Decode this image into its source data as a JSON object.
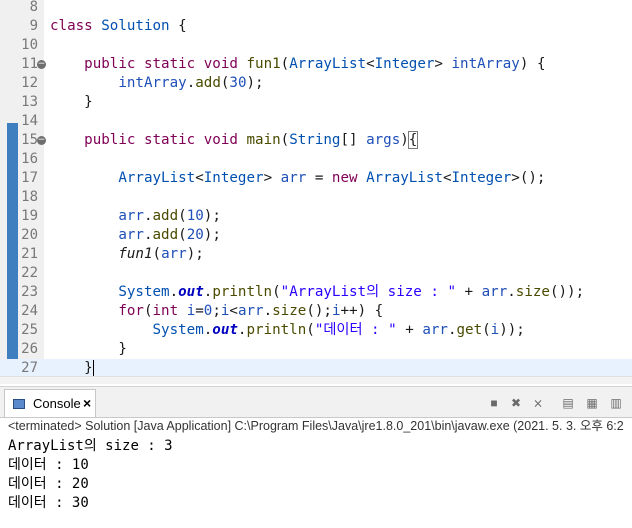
{
  "editor": {
    "lines": [
      {
        "num": "8",
        "text": ""
      },
      {
        "num": "9",
        "text": "class Solution {"
      },
      {
        "num": "10",
        "text": ""
      },
      {
        "num": "11",
        "text": "    public static void fun1(ArrayList<Integer> intArray) {"
      },
      {
        "num": "12",
        "text": "        intArray.add(30);"
      },
      {
        "num": "13",
        "text": "    }"
      },
      {
        "num": "14",
        "text": ""
      },
      {
        "num": "15",
        "text": "    public static void main(String[] args){"
      },
      {
        "num": "16",
        "text": ""
      },
      {
        "num": "17",
        "text": "        ArrayList<Integer> arr = new ArrayList<Integer>();"
      },
      {
        "num": "18",
        "text": ""
      },
      {
        "num": "19",
        "text": "        arr.add(10);"
      },
      {
        "num": "20",
        "text": "        arr.add(20);"
      },
      {
        "num": "21",
        "text": "        fun1(arr);"
      },
      {
        "num": "22",
        "text": ""
      },
      {
        "num": "23",
        "text": "        System.out.println(\"ArrayList의 size : \" + arr.size());"
      },
      {
        "num": "24",
        "text": "        for(int i=0;i<arr.size();i++) {"
      },
      {
        "num": "25",
        "text": "            System.out.println(\"데이터 : \" + arr.get(i));"
      },
      {
        "num": "26",
        "text": "        }"
      },
      {
        "num": "27",
        "text": "    }"
      }
    ]
  },
  "console": {
    "tab_label": "Console",
    "status": "<terminated> Solution [Java Application] C:\\Program Files\\Java\\jre1.8.0_201\\bin\\javaw.exe (2021. 5. 3. 오후 6:2",
    "output": [
      "ArrayList의 size : 3",
      "데이터 : 10",
      "데이터 : 20",
      "데이터 : 30"
    ]
  },
  "toolbar": {
    "icons": [
      "terminate-icon",
      "remove-launch-icon",
      "remove-all-terminated-icon",
      "scroll-lock-icon",
      "show-on-stdout-icon",
      "show-on-stderr-icon",
      "pin-console-icon"
    ]
  },
  "colors": {
    "keyword": "#7f0055",
    "type": "#0050b0",
    "string": "#2a00ff",
    "field_static": "#0000c0",
    "gutter_bar": "#3f7fbf"
  }
}
